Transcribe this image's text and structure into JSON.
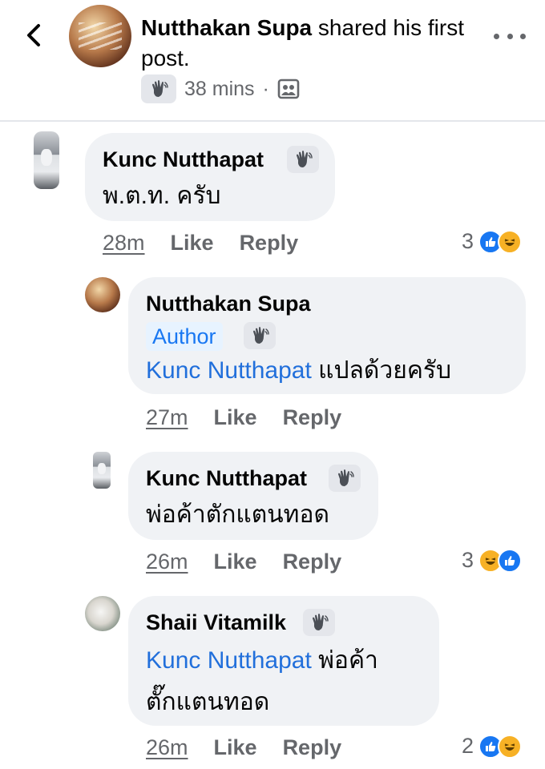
{
  "header": {
    "author_name": "Nutthakan Supa",
    "action_text": " shared his first post.",
    "time": "38 mins",
    "dot": "·",
    "icons": {
      "back": "chevron-left-icon",
      "wave": "waving-hand-icon",
      "audience": "group-audience-icon",
      "more": "more-horizontal-icon"
    }
  },
  "colors": {
    "mention": "#216fdb",
    "author_badge_bg": "#e7f3ff",
    "author_badge_text": "#1877f2",
    "like": "#1877f2",
    "haha": "#f7b125",
    "bubble": "#f0f2f5"
  },
  "comments": [
    {
      "name": "Kunc Nutthapat",
      "text": "พ.ต.ท. ครับ",
      "time": "28m",
      "like_label": "Like",
      "reply_label": "Reply",
      "reaction_count": "3",
      "reactions": [
        "like",
        "haha"
      ]
    },
    {
      "name": "Nutthakan Supa",
      "badge": "Author",
      "mention": "Kunc Nutthapat",
      "text": " แปลด้วยครับ",
      "time": "27m",
      "like_label": "Like",
      "reply_label": "Reply"
    },
    {
      "name": "Kunc Nutthapat",
      "text": "พ่อค้าตักแตนทอด",
      "time": "26m",
      "like_label": "Like",
      "reply_label": "Reply",
      "reaction_count": "3",
      "reactions": [
        "haha",
        "like"
      ]
    },
    {
      "name": "Shaii Vitamilk",
      "mention": "Kunc Nutthapat",
      "text_line1": " พ่อค้า",
      "text_line2": "ตั๊กแตนทอด",
      "time": "26m",
      "like_label": "Like",
      "reply_label": "Reply",
      "reaction_count": "2",
      "reactions": [
        "like",
        "haha"
      ]
    }
  ]
}
